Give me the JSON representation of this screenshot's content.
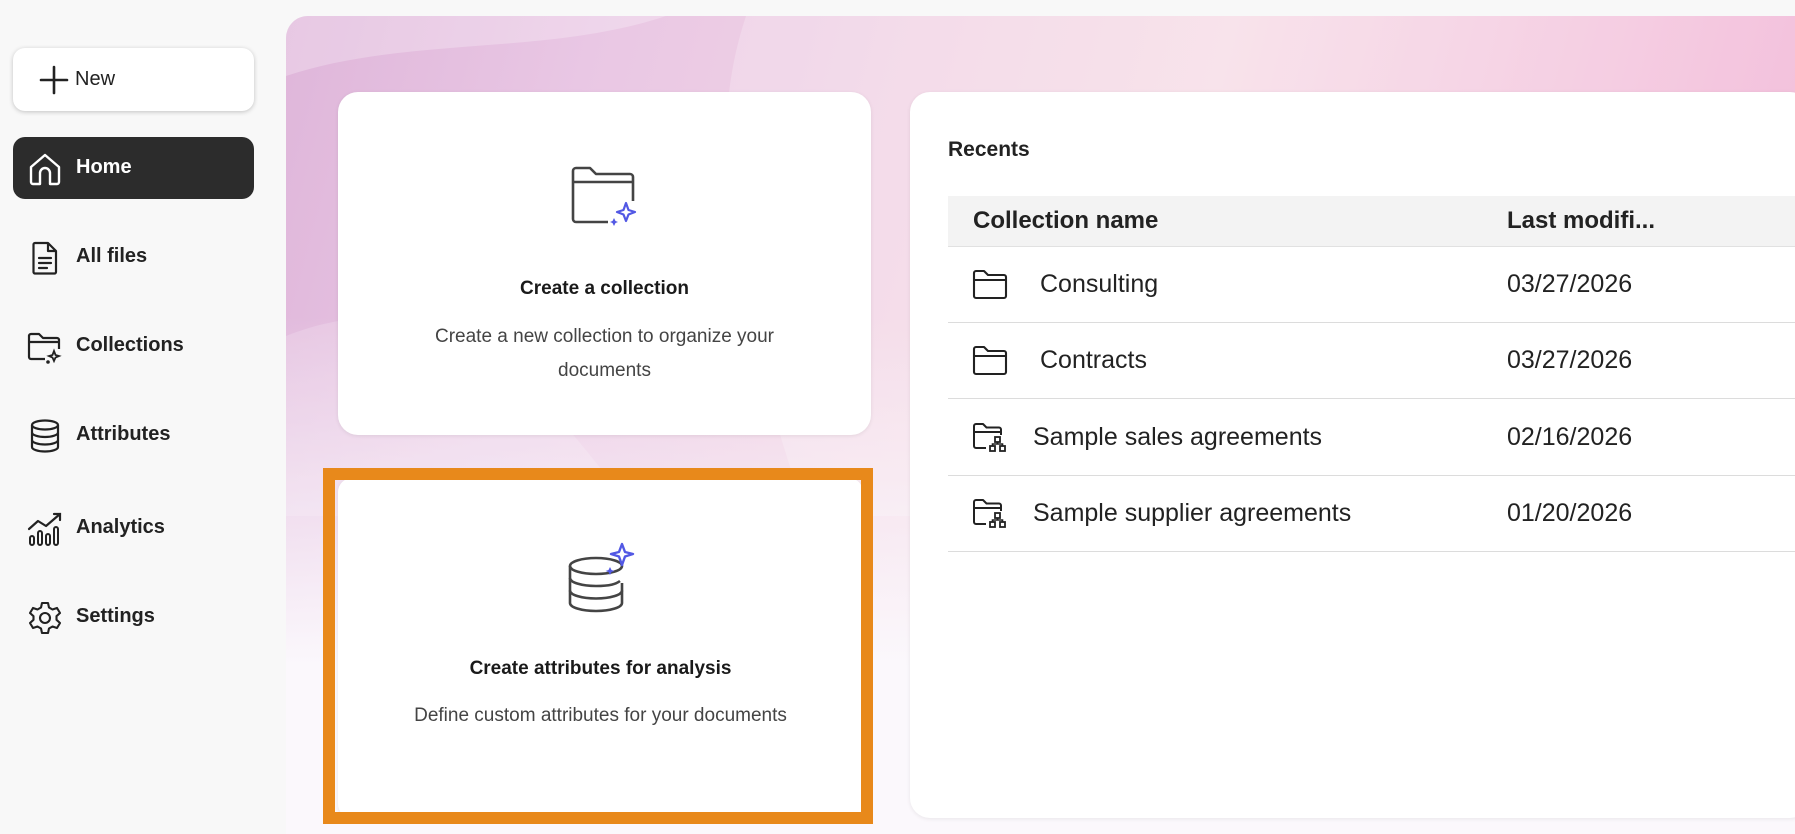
{
  "sidebar": {
    "new_label": "New",
    "items": [
      {
        "label": "Home",
        "icon": "home-icon",
        "active": true
      },
      {
        "label": "All files",
        "icon": "file-icon"
      },
      {
        "label": "Collections",
        "icon": "collections-icon"
      },
      {
        "label": "Attributes",
        "icon": "database-icon"
      },
      {
        "label": "Analytics",
        "icon": "analytics-icon"
      },
      {
        "label": "Settings",
        "icon": "gear-icon"
      }
    ]
  },
  "cards": {
    "collection": {
      "title": "Create a collection",
      "description": "Create a new collection to organize your documents",
      "icon": "folder-sparkle-icon"
    },
    "attributes": {
      "title": "Create attributes for analysis",
      "description": "Define custom attributes for your documents",
      "icon": "database-sparkle-icon"
    }
  },
  "recents": {
    "title": "Recents",
    "columns": [
      "Collection name",
      "Last modifi..."
    ],
    "rows": [
      {
        "name": "Consulting",
        "date": "03/27/2026",
        "icon": "folder-icon"
      },
      {
        "name": "Contracts",
        "date": "03/27/2026",
        "icon": "folder-icon"
      },
      {
        "name": "Sample sales agreements",
        "date": "02/16/2026",
        "icon": "shared-folder-icon"
      },
      {
        "name": "Sample supplier agreements",
        "date": "01/20/2026",
        "icon": "shared-folder-icon"
      }
    ]
  },
  "colors": {
    "accent": "#5258e4",
    "highlight": "#e8891b",
    "active_nav": "#2c2c2c"
  }
}
